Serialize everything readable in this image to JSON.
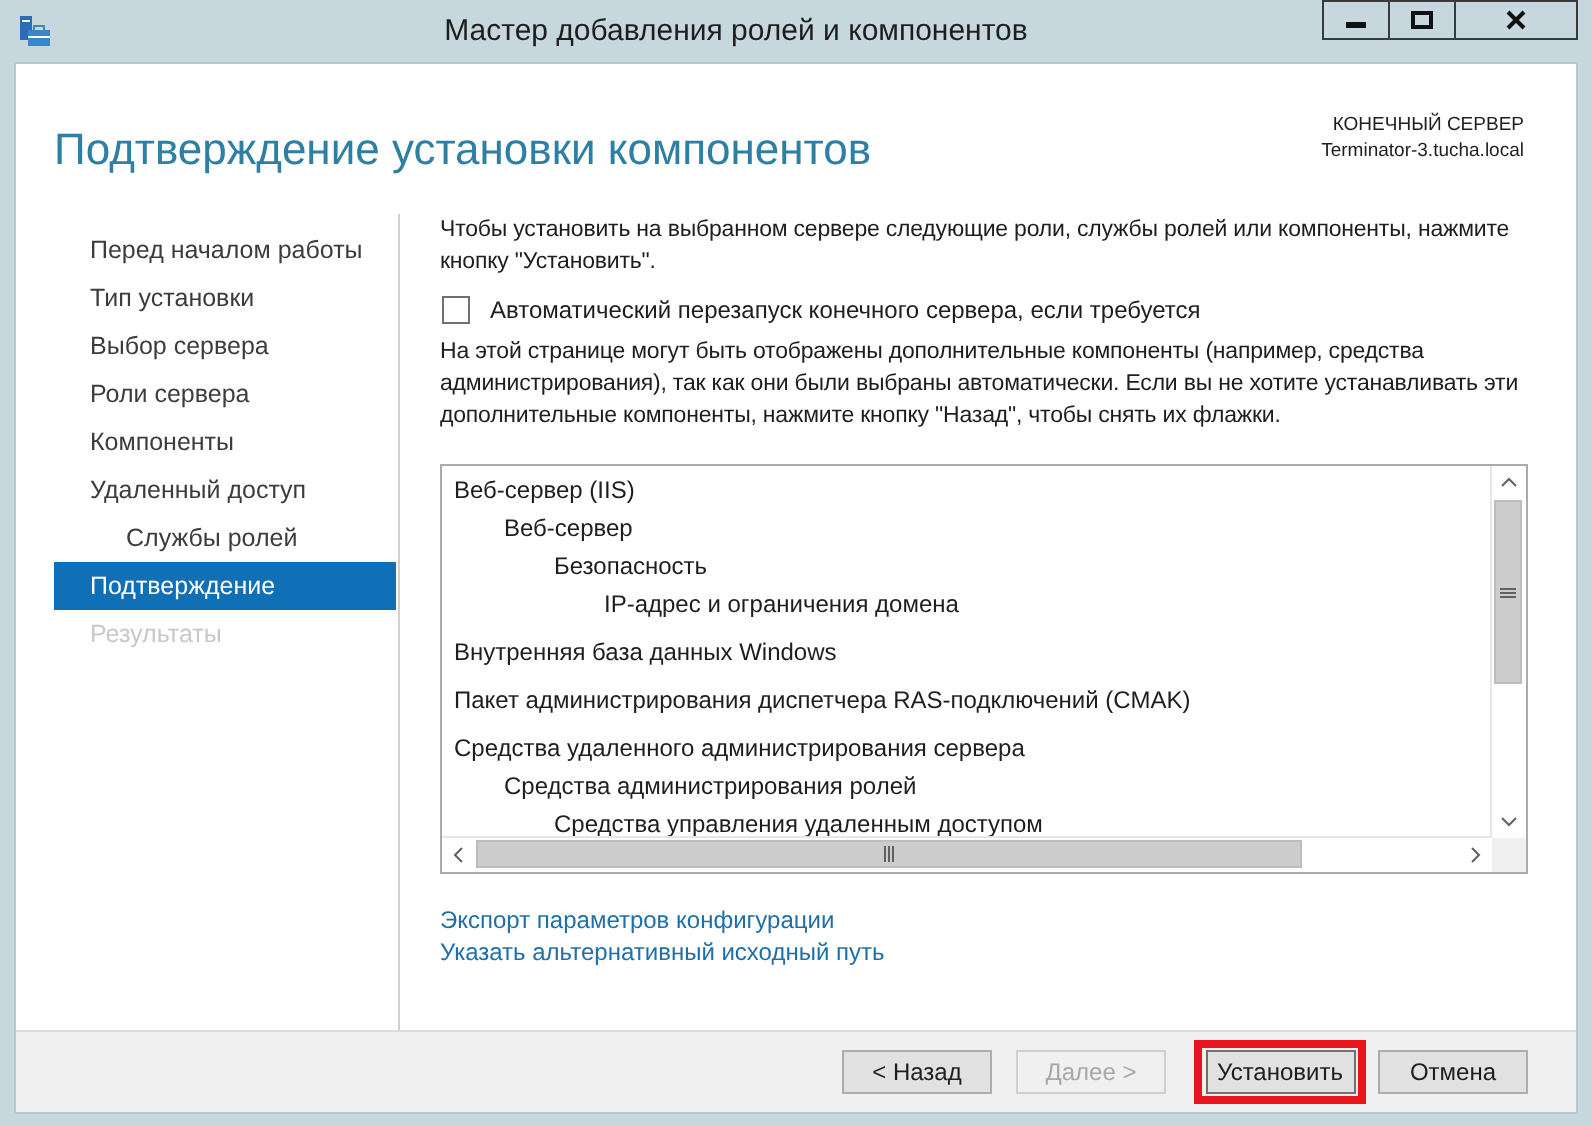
{
  "window": {
    "title": "Мастер добавления ролей и компонентов"
  },
  "header": {
    "title": "Подтверждение установки компонентов",
    "server_label": "КОНЕЧНЫЙ СЕРВЕР",
    "server_name": "Terminator-3.tucha.local"
  },
  "sidebar": {
    "items": [
      {
        "label": "Перед началом работы",
        "selected": false,
        "disabled": false
      },
      {
        "label": "Тип установки",
        "selected": false,
        "disabled": false
      },
      {
        "label": "Выбор сервера",
        "selected": false,
        "disabled": false
      },
      {
        "label": "Роли сервера",
        "selected": false,
        "disabled": false
      },
      {
        "label": "Компоненты",
        "selected": false,
        "disabled": false
      },
      {
        "label": "Удаленный доступ",
        "selected": false,
        "disabled": false,
        "children": [
          {
            "label": "Службы ролей",
            "selected": false,
            "disabled": false
          }
        ]
      },
      {
        "label": "Подтверждение",
        "selected": true,
        "disabled": false
      },
      {
        "label": "Результаты",
        "selected": false,
        "disabled": true
      }
    ]
  },
  "intro": "Чтобы установить на выбранном сервере следующие роли, службы ролей или компоненты, нажмите кнопку \"Установить\".",
  "restart_checkbox": {
    "label": "Автоматический перезапуск конечного сервера, если требуется",
    "checked": false
  },
  "note": "На этой странице могут быть отображены дополнительные компоненты (например, средства администрирования), так как они были выбраны автоматически. Если вы не хотите устанавливать эти дополнительные компоненты, нажмите кнопку \"Назад\", чтобы снять их флажки.",
  "features": [
    {
      "label": "Веб-сервер (IIS)",
      "children": [
        {
          "label": "Веб-сервер",
          "children": [
            {
              "label": "Безопасность",
              "children": [
                {
                  "label": "IP-адрес и ограничения домена"
                }
              ]
            }
          ]
        }
      ]
    },
    {
      "label": "Внутренняя база данных Windows"
    },
    {
      "label": "Пакет администрирования диспетчера RAS-подключений (CMAK)"
    },
    {
      "label": "Средства удаленного администрирования сервера",
      "children": [
        {
          "label": "Средства администрирования ролей",
          "children": [
            {
              "label": "Средства управления удаленным доступом"
            }
          ]
        }
      ]
    }
  ],
  "links": [
    "Экспорт параметров конфигурации",
    "Указать альтернативный исходный путь"
  ],
  "buttons": [
    {
      "label": "< Назад",
      "disabled": false,
      "highlighted": false
    },
    {
      "label": "Далее >",
      "disabled": true,
      "highlighted": false
    },
    {
      "label": "Установить",
      "disabled": false,
      "highlighted": true
    },
    {
      "label": "Отмена",
      "disabled": false,
      "highlighted": false
    }
  ]
}
